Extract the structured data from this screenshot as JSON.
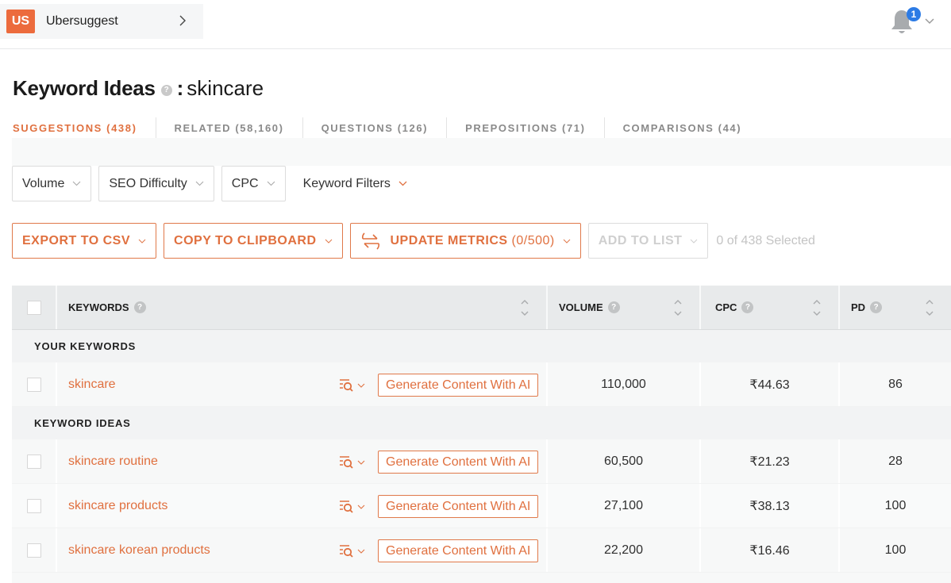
{
  "header": {
    "project_badge": "US",
    "project_name": "Ubersuggest",
    "notification_count": "1"
  },
  "page": {
    "title": "Keyword Ideas",
    "colon": ":",
    "search_term": "skincare",
    "help_glyph": "?"
  },
  "tabs": [
    {
      "label": "SUGGESTIONS (438)",
      "active": true
    },
    {
      "label": "RELATED (58,160)",
      "active": false
    },
    {
      "label": "QUESTIONS (126)",
      "active": false
    },
    {
      "label": "PREPOSITIONS (71)",
      "active": false
    },
    {
      "label": "COMPARISONS (44)",
      "active": false
    }
  ],
  "filters": [
    "Volume",
    "SEO Difficulty",
    "CPC",
    "Keyword Filters"
  ],
  "actions": {
    "export": "EXPORT TO CSV",
    "copy": "COPY TO CLIPBOARD",
    "update": "UPDATE METRICS",
    "update_count": "(0/500)",
    "add_to_list": "ADD TO LIST",
    "selected": "0 of 438 Selected"
  },
  "table": {
    "columns": [
      "KEYWORDS",
      "VOLUME",
      "CPC",
      "PD"
    ],
    "sections": {
      "your_keywords": "YOUR KEYWORDS",
      "keyword_ideas": "KEYWORD IDEAS"
    },
    "generate_label": "Generate Content With AI",
    "your_keywords": [
      {
        "keyword": "skincare",
        "volume": "110,000",
        "cpc": "₹44.63",
        "pd": "86"
      }
    ],
    "keyword_ideas": [
      {
        "keyword": "skincare routine",
        "volume": "60,500",
        "cpc": "₹21.23",
        "pd": "28"
      },
      {
        "keyword": "skincare products",
        "volume": "27,100",
        "cpc": "₹38.13",
        "pd": "100"
      },
      {
        "keyword": "skincare korean products",
        "volume": "22,200",
        "cpc": "₹16.46",
        "pd": "100"
      }
    ]
  },
  "colors": {
    "accent": "#e0703f",
    "brand_badge": "#ec6b3d",
    "notification": "#2c7be5"
  }
}
